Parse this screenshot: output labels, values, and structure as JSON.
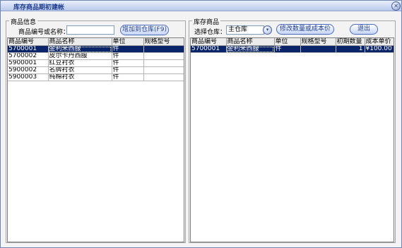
{
  "window": {
    "title": "库存商品期初建帐",
    "close_label": "✕"
  },
  "left": {
    "group_title": "商品信息",
    "search_label": "商品编号或名称：",
    "search_value": "",
    "add_button": "增加到仓库(F9)",
    "columns": [
      "商品编号",
      "商品名称",
      "单位",
      "规格型号"
    ],
    "rows": [
      {
        "code": "5700001",
        "name": "金利来西服",
        "unit": "件",
        "spec": "",
        "selected": true
      },
      {
        "code": "5700002",
        "name": "皮尔卡丹西服",
        "unit": "件",
        "spec": "",
        "selected": false
      },
      {
        "code": "5900001",
        "name": "红豆衬衣",
        "unit": "件",
        "spec": "",
        "selected": false
      },
      {
        "code": "5900002",
        "name": "名牌衬衣",
        "unit": "件",
        "spec": "",
        "selected": false
      },
      {
        "code": "5900003",
        "name": "纯棉衬衣",
        "unit": "件",
        "spec": "",
        "selected": false
      }
    ]
  },
  "right": {
    "group_title": "库存商品",
    "warehouse_label": "选择仓库：",
    "warehouse_value": "主仓库",
    "modify_button": "修改数量或成本价",
    "exit_button": "退出",
    "columns": [
      "商品编号",
      "商品名称",
      "单位",
      "规格型号",
      "初期数量",
      "成本单价"
    ],
    "rows": [
      {
        "code": "5700001",
        "name": "金利来西服",
        "unit": "件",
        "spec": "",
        "qty": "1",
        "price": "¥100.00",
        "selected": true
      }
    ]
  },
  "colors": {
    "selection": "#0a246a",
    "title_text": "#1d3c8f"
  }
}
